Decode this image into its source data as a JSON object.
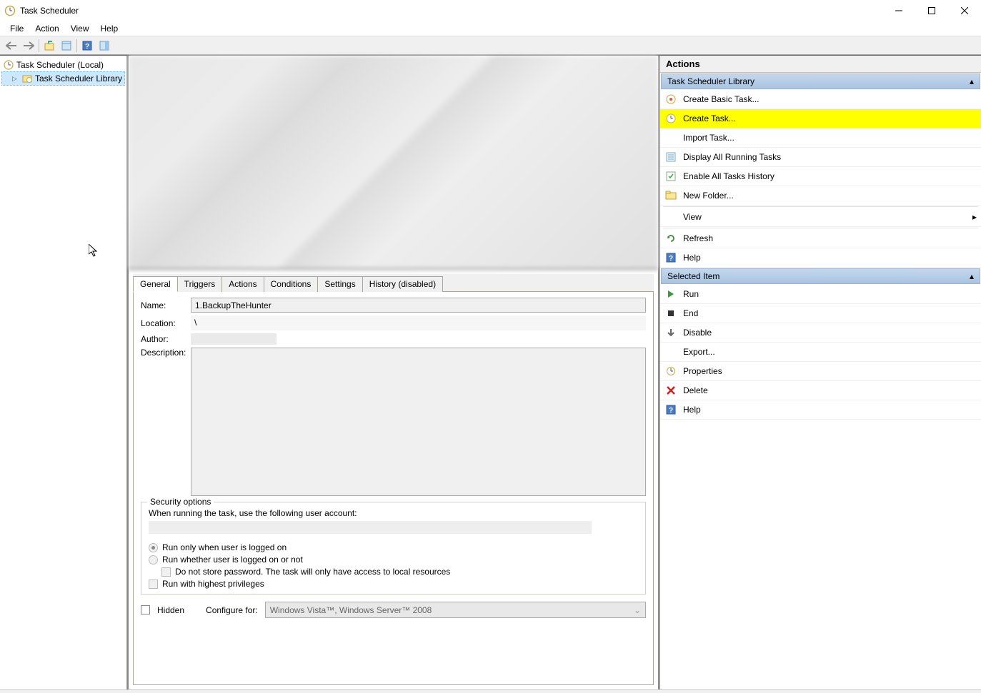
{
  "window": {
    "title": "Task Scheduler"
  },
  "menu": {
    "file": "File",
    "action": "Action",
    "view": "View",
    "help": "Help"
  },
  "tree": {
    "root": "Task Scheduler (Local)",
    "library": "Task Scheduler Library"
  },
  "tabs": {
    "general": "General",
    "triggers": "Triggers",
    "actions": "Actions",
    "conditions": "Conditions",
    "settings": "Settings",
    "history": "History (disabled)"
  },
  "general": {
    "label_name": "Name:",
    "name_value": "1.BackupTheHunter",
    "label_location": "Location:",
    "location_value": "\\",
    "label_author": "Author:",
    "label_description": "Description:",
    "security_legend": "Security options",
    "security_text": "When running the task, use the following user account:",
    "opt_run_only": "Run only when user is logged on",
    "opt_run_whether": "Run whether user is logged on or not",
    "opt_no_store": "Do not store password.  The task will only have access to local resources",
    "opt_highest": "Run with highest privileges",
    "hidden": "Hidden",
    "configure_for": "Configure for:",
    "configure_value": "Windows Vista™, Windows Server™ 2008"
  },
  "actions_pane": {
    "header": "Actions",
    "section1": "Task Scheduler Library",
    "items1": {
      "create_basic": "Create Basic Task...",
      "create_task": "Create Task...",
      "import_task": "Import Task...",
      "display_running": "Display All Running Tasks",
      "enable_history": "Enable All Tasks History",
      "new_folder": "New Folder...",
      "view": "View",
      "refresh": "Refresh",
      "help": "Help"
    },
    "section2": "Selected Item",
    "items2": {
      "run": "Run",
      "end": "End",
      "disable": "Disable",
      "export": "Export...",
      "properties": "Properties",
      "delete": "Delete",
      "help": "Help"
    }
  }
}
